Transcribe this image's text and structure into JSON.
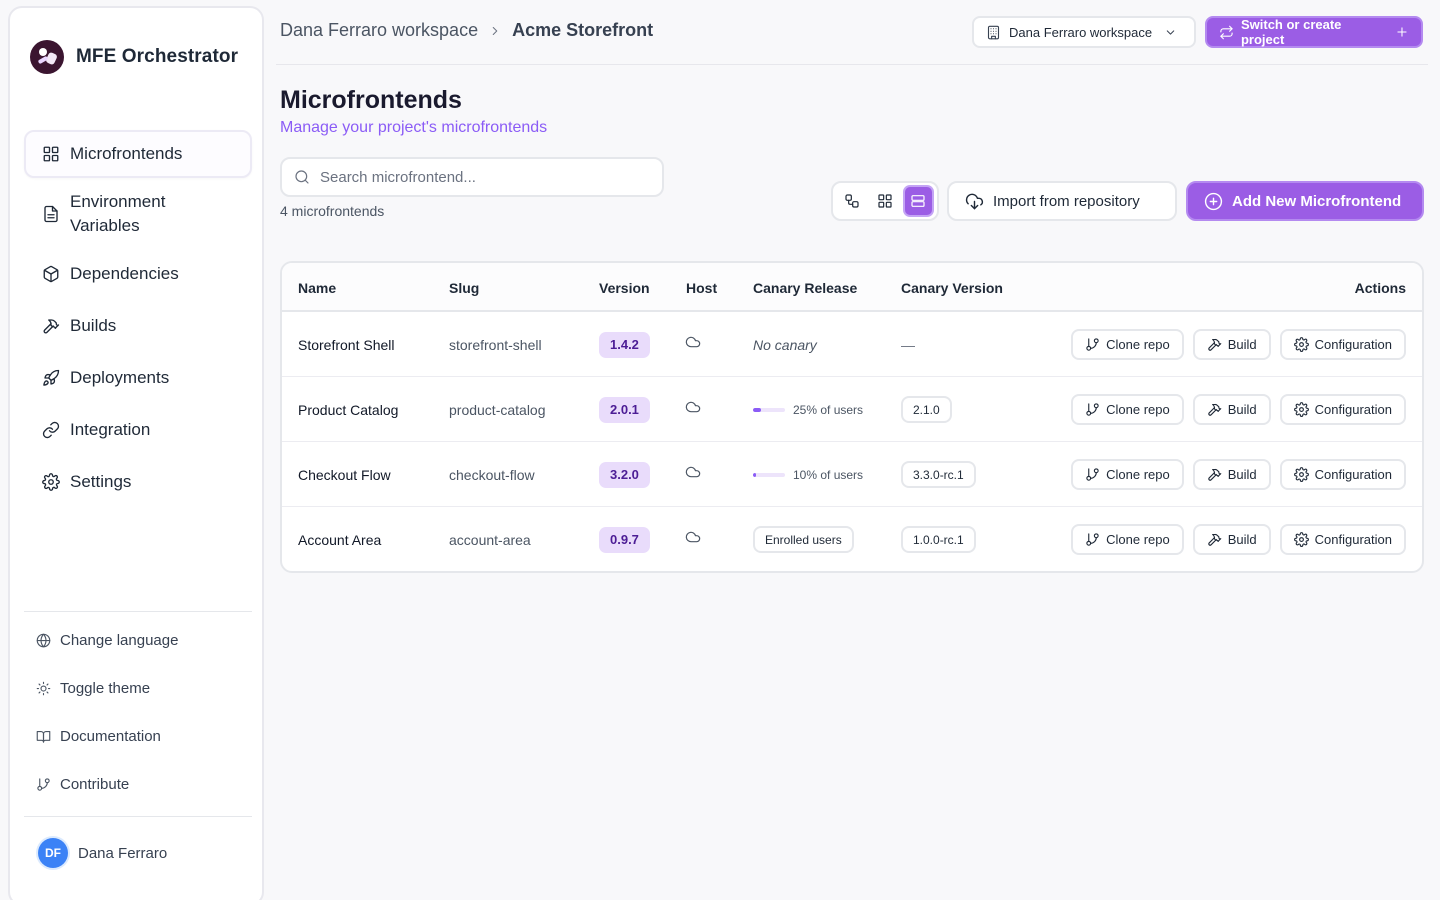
{
  "app": {
    "name": "MFE Orchestrator"
  },
  "sidebar": {
    "items": [
      {
        "label": "Microfrontends",
        "icon": "grid-icon",
        "active": true
      },
      {
        "label": "Environment Variables",
        "icon": "file-text-icon"
      },
      {
        "label": "Dependencies",
        "icon": "package-icon"
      },
      {
        "label": "Builds",
        "icon": "hammer-icon"
      },
      {
        "label": "Deployments",
        "icon": "rocket-icon"
      },
      {
        "label": "Integration",
        "icon": "link-icon"
      },
      {
        "label": "Settings",
        "icon": "gear-icon"
      }
    ],
    "utilities": [
      {
        "label": "Change language",
        "icon": "globe-icon"
      },
      {
        "label": "Toggle theme",
        "icon": "sun-icon"
      },
      {
        "label": "Documentation",
        "icon": "book-icon"
      },
      {
        "label": "Contribute",
        "icon": "git-branch-icon"
      }
    ],
    "user": {
      "initials": "DF",
      "name": "Dana Ferraro"
    }
  },
  "topbar": {
    "breadcrumb": [
      "Dana Ferraro workspace",
      "Acme Storefront"
    ],
    "workspace_select": "Dana Ferraro workspace",
    "switch_label": "Switch or create project"
  },
  "header": {
    "title": "Microfrontends",
    "subtitle": "Manage your project's microfrontends"
  },
  "search": {
    "placeholder": "Search microfrontend...",
    "value": ""
  },
  "count_label": "4 microfrontends",
  "toolbar": {
    "import_label": "Import from repository",
    "add_label": "Add New Microfrontend",
    "view_modes": [
      "graph",
      "grid",
      "list"
    ],
    "active_view": "list"
  },
  "table": {
    "columns": {
      "name": "Name",
      "slug": "Slug",
      "version": "Version",
      "host": "Host",
      "canary": "Canary Release",
      "canary_version": "Canary Version",
      "actions": "Actions"
    },
    "action_labels": {
      "clone": "Clone repo",
      "build": "Build",
      "config": "Configuration"
    },
    "rows": [
      {
        "name": "Storefront Shell",
        "slug": "storefront-shell",
        "version": "1.4.2",
        "canary_type": "none",
        "canary_text": "No canary",
        "canary_version": "—"
      },
      {
        "name": "Product Catalog",
        "slug": "product-catalog",
        "version": "2.0.1",
        "canary_type": "percent",
        "canary_percent": 25,
        "canary_text": "25% of users",
        "canary_version": "2.1.0"
      },
      {
        "name": "Checkout Flow",
        "slug": "checkout-flow",
        "version": "3.2.0",
        "canary_type": "percent",
        "canary_percent": 10,
        "canary_text": "10% of users",
        "canary_version": "3.3.0-rc.1"
      },
      {
        "name": "Account Area",
        "slug": "account-area",
        "version": "0.9.7",
        "canary_type": "enrolled",
        "canary_text": "Enrolled users",
        "canary_version": "1.0.0-rc.1"
      }
    ]
  },
  "colors": {
    "accent": "#9b5de5",
    "accent_text": "#8b5cf6",
    "version_pill": "#e9dcfb"
  }
}
